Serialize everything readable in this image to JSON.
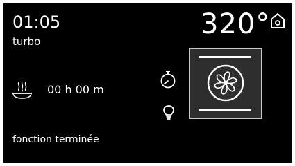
{
  "display": {
    "time": "01:05",
    "mode": "turbo",
    "temperature": "320°",
    "duration": "00 h 00 m",
    "status": "fonction terminée"
  },
  "icons": {
    "home": "home-icon",
    "steam": "steam-cooking-icon",
    "timer": "timer-icon",
    "light": "light-bulb-icon",
    "fan": "turbo-fan-icon"
  },
  "colors": {
    "background": "#000000",
    "text": "#ffffff",
    "panel_background": "#2e2e2e",
    "panel_border": "#c8c8c8"
  }
}
